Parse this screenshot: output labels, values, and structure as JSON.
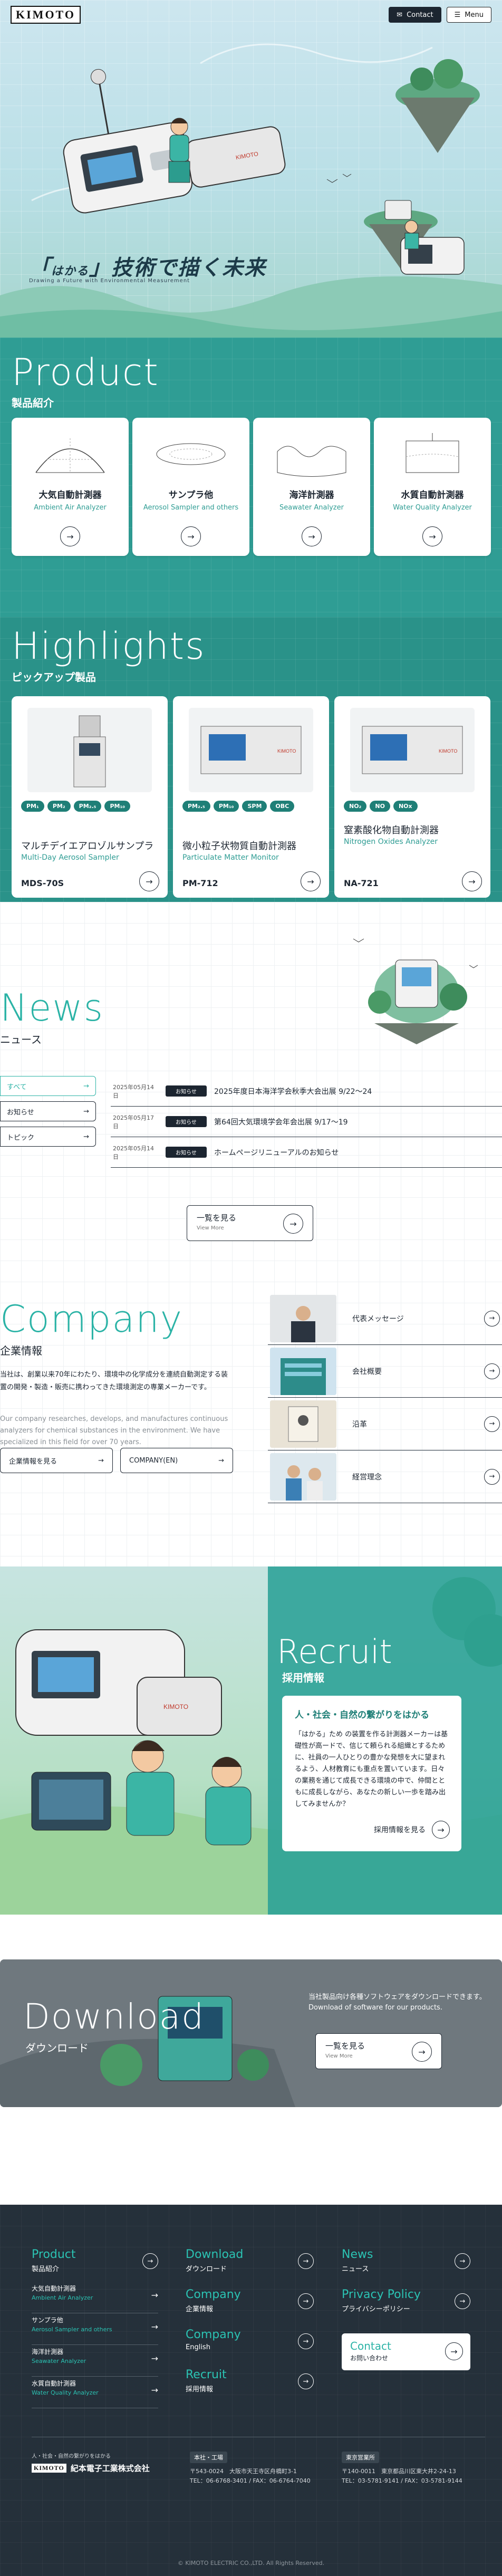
{
  "header": {
    "logo": "KIMOTO",
    "contact_label": "Contact",
    "menu_label": "Menu"
  },
  "hero": {
    "tagline_a": "はかる",
    "tagline_b": "技術で描く",
    "tagline_c": "未来",
    "tagline_en": "Drawing a Future with Environmental Measurement"
  },
  "product": {
    "title_en": "Product",
    "title_jp": "製品紹介",
    "items": [
      {
        "jp": "大気自動計測器",
        "en": "Ambient Air Analyzer"
      },
      {
        "jp": "サンプラ他",
        "en": "Aerosol Sampler and others"
      },
      {
        "jp": "海洋計測器",
        "en": "Seawater Analyzer"
      },
      {
        "jp": "水質自動計測器",
        "en": "Water Quality Analyzer"
      }
    ]
  },
  "highlights": {
    "title_en": "Highlights",
    "title_jp": "ピックアップ製品",
    "items": [
      {
        "tags": [
          "PM₁",
          "PM₂",
          "PM₂.₅",
          "PM₁₀"
        ],
        "jp": "マルチデイエアロゾルサンプラ",
        "en": "Multi-Day Aerosol Sampler",
        "model": "MDS-70S"
      },
      {
        "tags": [
          "PM₂.₅",
          "PM₁₀",
          "SPM",
          "OBC"
        ],
        "jp": "微小粒子状物質自動計測器",
        "en": "Particulate Matter Monitor",
        "model": "PM-712"
      },
      {
        "tags": [
          "NO₂",
          "NO",
          "NOx"
        ],
        "jp": "窒素酸化物自動計測器",
        "en": "Nitrogen Oxides Analyzer",
        "model": "NA-721"
      }
    ]
  },
  "news": {
    "title_en": "News",
    "title_jp": "ニュース",
    "filters": [
      "すべて",
      "お知らせ",
      "トピック"
    ],
    "rows": [
      {
        "date": "2025年05月14日",
        "cat": "お知らせ",
        "title": "2025年度日本海洋学会秋季大会出展 9/22～24"
      },
      {
        "date": "2025年05月17日",
        "cat": "お知らせ",
        "title": "第64回大気環境学会年会出展 9/17～19"
      },
      {
        "date": "2025年05月14日",
        "cat": "お知らせ",
        "title": "ホームページリニューアルのお知らせ"
      }
    ],
    "more_jp": "一覧を見る",
    "more_en": "View More"
  },
  "company": {
    "title_en": "Company",
    "title_jp": "企業情報",
    "desc_jp": "当社は、創業以来70年にわたり、環境中の化学成分を連続自動測定する装置の開発・製造・販売に携わってきた環境測定の専業メーカーです。",
    "desc_en": "Our company researches, develops, and manufactures continuous analyzers for chemical substances in the environment. We have specialized in this field for over 70 years.",
    "btn1": "企業情報を見る",
    "btn2": "COMPANY(EN)",
    "rows": [
      "代表メッセージ",
      "会社概要",
      "沿革",
      "経営理念"
    ]
  },
  "recruit": {
    "title_en": "Recruit",
    "title_jp": "採用情報",
    "headline": "人・社会・自然の繋がりをはかる",
    "body": "「はかる」ため の装置を作る計測器メーカーは基礎性が高ードで、信じて頼られる組織とするために、社員の一人ひとりの豊かな発想を大に望まれるよう、人材教育にも重点を置いています。日々の業務を通じて成長できる環境の中で、仲間とともに成長しながら、あなたの新しい一歩を踏み出してみませんか？",
    "link": "採用情報を見る"
  },
  "download": {
    "title_en": "Download",
    "title_jp": "ダウンロード",
    "desc_jp": "当社製品向け各種ソフトウェアをダウンロードできます。",
    "desc_en": "Download of software for our products.",
    "more_jp": "一覧を見る",
    "more_en": "View More"
  },
  "footer": {
    "product_en": "Product",
    "product_jp": "製品紹介",
    "subs": [
      {
        "a": "大気自動計測器",
        "b": "Ambient Air Analyzer"
      },
      {
        "a": "サンプラ他",
        "b": "Aerosol Sampler and others"
      },
      {
        "a": "海洋計測器",
        "b": "Seawater Analyzer"
      },
      {
        "a": "水質自動計測器",
        "b": "Water Quality Analyzer"
      }
    ],
    "download_en": "Download",
    "download_jp": "ダウンロード",
    "company_en": "Company",
    "company_jp": "企業情報",
    "english_en": "Company",
    "english_jp": "English",
    "recruit_en": "Recruit",
    "recruit_jp": "採用情報",
    "news_en": "News",
    "news_jp": "ニュース",
    "privacy_en": "Privacy Policy",
    "privacy_jp": "プライバシーポリシー",
    "contact_en": "Contact",
    "contact_jp": "お問い合わせ",
    "company_tag": "人・社会・自然の繋がりをはかる",
    "company_name": "紀本電子工業株式会社",
    "hq_label": "本社・工場",
    "hq_addr": "〒543-0024　大阪市天王寺区舟橋町3-1",
    "hq_tel": "TEL：06-6768-3401 / FAX：06-6764-7040",
    "tokyo_label": "東京営業所",
    "tokyo_addr": "〒140-0011　東京都品川区東大井2-24-13",
    "tokyo_tel": "TEL：03-5781-9141 / FAX：03-5781-9144",
    "copyright": "© KIMOTO ELECTRIC CO.,LTD. All Rights Reserved."
  },
  "colors": {
    "teal": "#2f9d94",
    "accent": "#2bb3a6",
    "navy": "#1c2530"
  }
}
